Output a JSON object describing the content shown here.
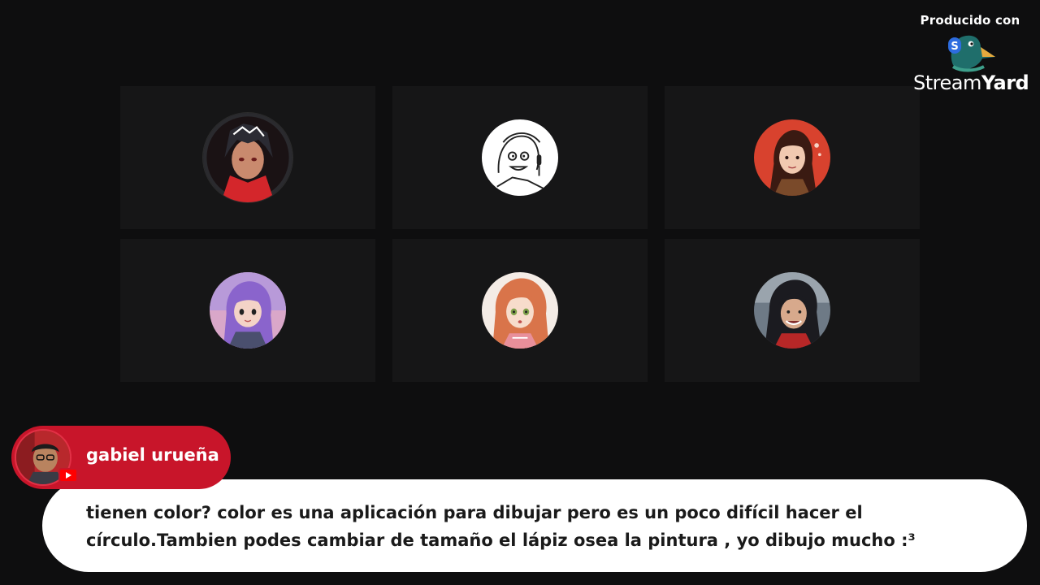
{
  "branding": {
    "produced_with": "Producido con",
    "name_light": "Stream",
    "name_bold": "Yard",
    "icon": "streamyard-duck-icon"
  },
  "participants": [
    {
      "icon": "participant-avatar-icon",
      "speaking": true
    },
    {
      "icon": "participant-avatar-icon",
      "speaking": false
    },
    {
      "icon": "participant-avatar-icon",
      "speaking": false
    },
    {
      "icon": "participant-avatar-icon",
      "speaking": false
    },
    {
      "icon": "participant-avatar-icon",
      "speaking": false
    },
    {
      "icon": "participant-avatar-icon",
      "speaking": false
    }
  ],
  "comment": {
    "author": "gabiel urueña",
    "platform_icon": "youtube-icon",
    "text": "tienen color? color es una aplicación para dibujar pero es un poco difícil hacer el círculo.Tambien podes cambiar de tamaño el lápiz osea la pintura , yo dibujo mucho :³"
  },
  "colors": {
    "background": "#0e0e0f",
    "tile": "#161617",
    "author_pill": "#c8152a",
    "comment_bg": "#ffffff"
  }
}
